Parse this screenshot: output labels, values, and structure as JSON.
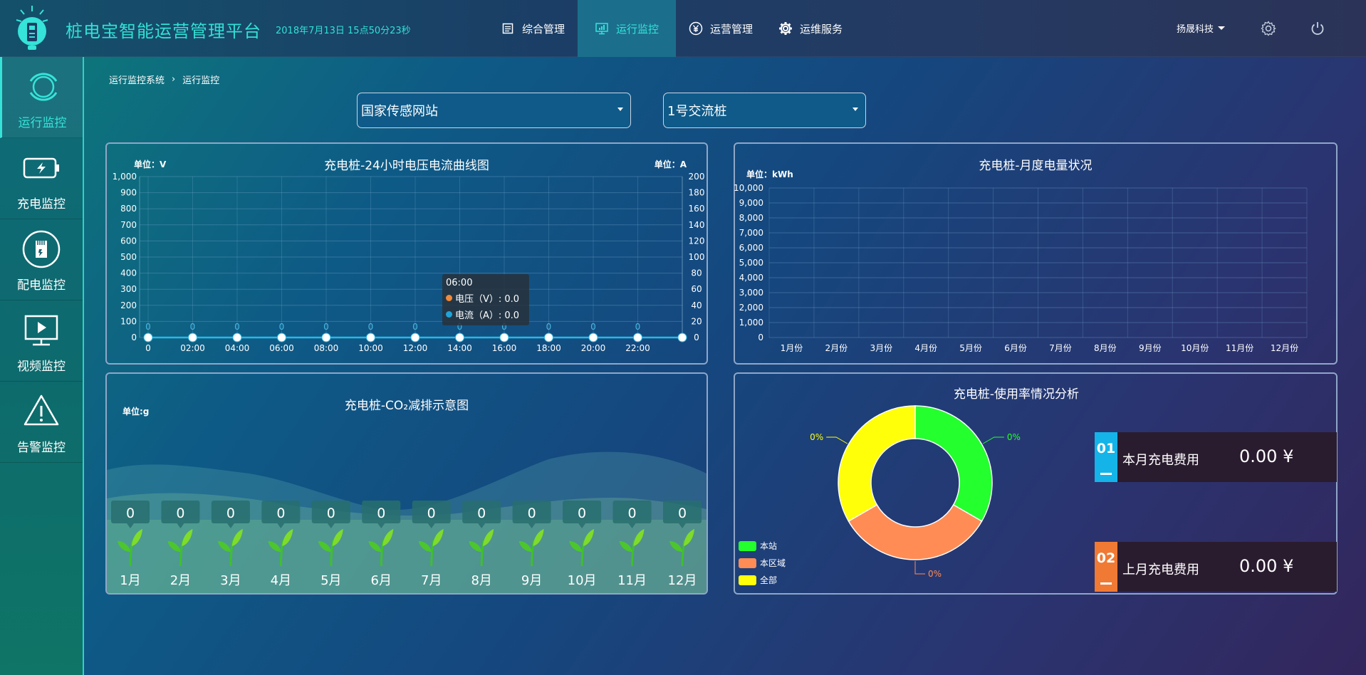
{
  "header": {
    "title": "桩电宝智能运营管理平台",
    "datetime": "2018年7月13日  15点50分23秒",
    "nav": [
      {
        "label": "综合管理",
        "icon": "list-icon"
      },
      {
        "label": "运行监控",
        "icon": "monitor-chart-icon",
        "active": true
      },
      {
        "label": "运营管理",
        "icon": "yen-icon"
      },
      {
        "label": "运维服务",
        "icon": "gear-icon"
      }
    ],
    "user": "扬晟科技"
  },
  "sidebar": {
    "items": [
      {
        "label": "运行监控",
        "icon": "ring-monitor-icon",
        "active": true
      },
      {
        "label": "充电监控",
        "icon": "battery-icon"
      },
      {
        "label": "配电监控",
        "icon": "chip-icon"
      },
      {
        "label": "视频监控",
        "icon": "video-play-icon"
      },
      {
        "label": "告警监控",
        "icon": "warning-icon"
      }
    ]
  },
  "breadcrumb": {
    "root": "运行监控系统",
    "sep": "›",
    "current": "运行监控"
  },
  "selects": {
    "site": "国家传感网站",
    "pile": "1号交流桩"
  },
  "panels": {
    "voltage": {
      "title": "充电桩-24小时电压电流曲线图",
      "unit_left": "单位：V",
      "unit_right": "单位：A",
      "tooltip": {
        "time": "06:00",
        "voltage": "电压（V）: 0.0",
        "current": "电流（A）: 0.0"
      }
    },
    "monthly": {
      "title": "充电桩-月度电量状况",
      "unit": "单位：kWh"
    },
    "co2": {
      "title": "充电桩-CO₂减排示意图",
      "unit": "单位:g"
    },
    "usage": {
      "title": "充电桩-使用率情况分析"
    }
  },
  "fees": [
    {
      "badge": "01",
      "label": "本月充电费用",
      "value": "0.00 ¥",
      "color": "#14b4e8"
    },
    {
      "badge": "02",
      "label": "上月充电费用",
      "value": "0.00 ¥",
      "color": "#f07a34"
    }
  ],
  "colors": {
    "accent": "#35e3d8",
    "voltage": "#f08a3c",
    "current": "#1fa4d8"
  },
  "chart_data": [
    {
      "type": "line",
      "title": "充电桩-24小时电压电流曲线图",
      "x": [
        "0",
        "02:00",
        "04:00",
        "06:00",
        "08:00",
        "10:00",
        "12:00",
        "14:00",
        "16:00",
        "18:00",
        "20:00",
        "22:00",
        ""
      ],
      "y_left_ticks": [
        "0",
        "100",
        "200",
        "300",
        "400",
        "500",
        "600",
        "700",
        "800",
        "900",
        "1,000"
      ],
      "y_right_ticks": [
        "0",
        "20",
        "40",
        "60",
        "80",
        "100",
        "120",
        "140",
        "160",
        "180",
        "200"
      ],
      "ylim_left": [
        0,
        1000
      ],
      "ylim_right": [
        0,
        200
      ],
      "series": [
        {
          "name": "电压（V）",
          "axis": "left",
          "values": [
            0,
            0,
            0,
            0,
            0,
            0,
            0,
            0,
            0,
            0,
            0,
            0,
            0
          ]
        },
        {
          "name": "电流（A）",
          "axis": "right",
          "values": [
            0,
            0,
            0,
            0,
            0,
            0,
            0,
            0,
            0,
            0,
            0,
            0,
            0
          ]
        }
      ],
      "point_labels": [
        "0",
        "0",
        "0",
        "0",
        "0",
        "0",
        "0",
        "0",
        "0",
        "0",
        "0",
        "0"
      ]
    },
    {
      "type": "bar",
      "title": "充电桩-月度电量状况",
      "categories": [
        "1月份",
        "2月份",
        "3月份",
        "4月份",
        "5月份",
        "6月份",
        "7月份",
        "8月份",
        "9月份",
        "10月份",
        "11月份",
        "12月份"
      ],
      "values": [
        0,
        0,
        0,
        0,
        0,
        0,
        0,
        0,
        0,
        0,
        0,
        0
      ],
      "y_ticks": [
        "0",
        "1,000",
        "2,000",
        "3,000",
        "4,000",
        "5,000",
        "6,000",
        "7,000",
        "8,000",
        "9,000",
        "10,000"
      ],
      "ylim": [
        0,
        10000
      ]
    },
    {
      "type": "bar",
      "title": "充电桩-CO₂减排示意图",
      "categories": [
        "1月",
        "2月",
        "3月",
        "4月",
        "5月",
        "6月",
        "7月",
        "8月",
        "9月",
        "10月",
        "11月",
        "12月"
      ],
      "values": [
        0,
        0,
        0,
        0,
        0,
        0,
        0,
        0,
        0,
        0,
        0,
        0
      ]
    },
    {
      "type": "pie",
      "title": "充电桩-使用率情况分析",
      "labels": [
        "本站",
        "本区域",
        "全部"
      ],
      "values": [
        0,
        0,
        0
      ],
      "slice_labels": [
        "0%",
        "0%",
        "0%"
      ],
      "colors": [
        "#24ff2e",
        "#ff8c55",
        "#ffff0a"
      ],
      "legend": "bottom-left"
    }
  ]
}
